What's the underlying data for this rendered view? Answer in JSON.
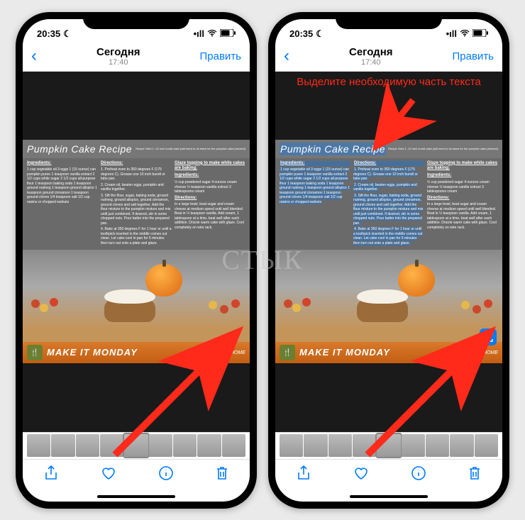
{
  "status": {
    "time": "20:35",
    "moon": "☽",
    "signal": "📶",
    "wifi": "✓",
    "battery": "▰"
  },
  "nav": {
    "back": "‹",
    "title": "Сегодня",
    "subtitle": "17:40",
    "edit": "Править"
  },
  "recipe": {
    "title": "Pumpkin Cake Recipe",
    "yield": "Recipe Yield 1 -10 inch bundt cake\n(will need to do twice for the\npumpkin cake pictured)",
    "col1_h": "Ingredients:",
    "col1": "1 cup vegetable oil\n3 eggs\n1 (15 ounce) can pumpkin puree\n1 teaspoon vanilla extract\n2 1/2 cups white sugar\n2 1/2 cups all-purpose flour\n1 teaspoon baking soda\n1 teaspoon ground nutmeg\n1 teaspoon ground allspice\n1 teaspoon ground cinnamon\n1 teaspoon ground cloves\n1/4 teaspoon salt\n1/2 cup raisins or chopped walnuts",
    "col2_h": "Directions:",
    "col2_1": "1. Preheat oven to 350 degrees F (175 degrees C). Grease one 10 inch bundt or tube pan.",
    "col2_2": "2. Cream oil, beaten eggs, pumpkin and vanilla together.",
    "col2_3": "3. Sift the flour, sugar, baking soda, ground nutmeg, ground allspice, ground cinnamon, ground cloves and salt together. Add the flour mixture to the pumpkin mixture and mix until just combined. If desired, stir in some chopped nuts. Pour batter into the prepared pan.",
    "col2_4": "4. Bake at 350 degrees F for 1 hour or until a toothpick inserted in the middle comes out clean. Let cake cool in pan for 5 minutes then turn out onto a plate and glaze.",
    "col3_h1": "Glaze topping to make while cakes are baking:",
    "col3_h2": "Ingredients:",
    "col3_ing": "½ cup powdered sugar\n4 ounces cream cheese\n½ teaspoon vanilla extract\n3 tablespoons cream",
    "col3_h3": "Directions:",
    "col3_dir": "In a large bowl, beat sugar and cream cheese at medium speed until well blended. Beat in ½ teaspoon vanilla. Add cream, 1 tablespoon at a time, beat well after each addition. Drizzle warm cake with glaze. Cool completely on wire rack."
  },
  "banner": {
    "text": "MAKE IT MONDAY",
    "right": "Celebrating HOME"
  },
  "toolbar": {
    "share": "share-icon",
    "like": "heart-icon",
    "info": "info-icon",
    "trash": "trash-icon"
  },
  "annotation_right": "Выделите необходимую\nчасть текста",
  "watermark": "СТЫК"
}
